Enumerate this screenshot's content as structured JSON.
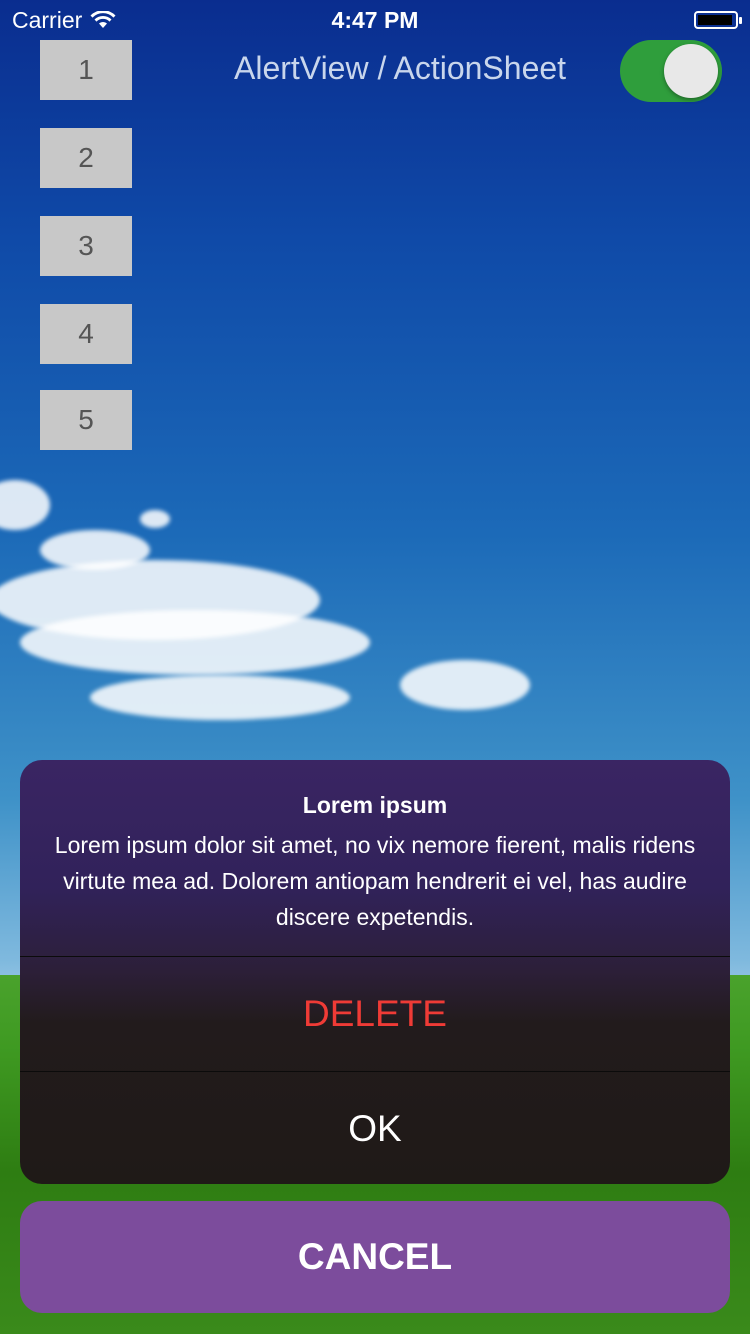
{
  "status_bar": {
    "carrier": "Carrier",
    "time": "4:47 PM",
    "battery_level": 0.95
  },
  "number_buttons": [
    "1",
    "2",
    "3",
    "4",
    "5"
  ],
  "header": {
    "title": "AlertView / ActionSheet",
    "toggle_on": true,
    "toggle_color": "#2f9e3c"
  },
  "action_sheet": {
    "title": "Lorem ipsum",
    "message": "Lorem ipsum dolor sit amet, no vix nemore fierent, malis ridens virtute mea ad. Dolorem antiopam hendrerit ei vel, has audire discere expetendis.",
    "actions": [
      {
        "label": "DELETE",
        "style": "destructive",
        "color": "#ef3b36"
      },
      {
        "label": "OK",
        "style": "default"
      }
    ],
    "cancel_label": "CANCEL",
    "cancel_color": "#7c4c9c"
  }
}
